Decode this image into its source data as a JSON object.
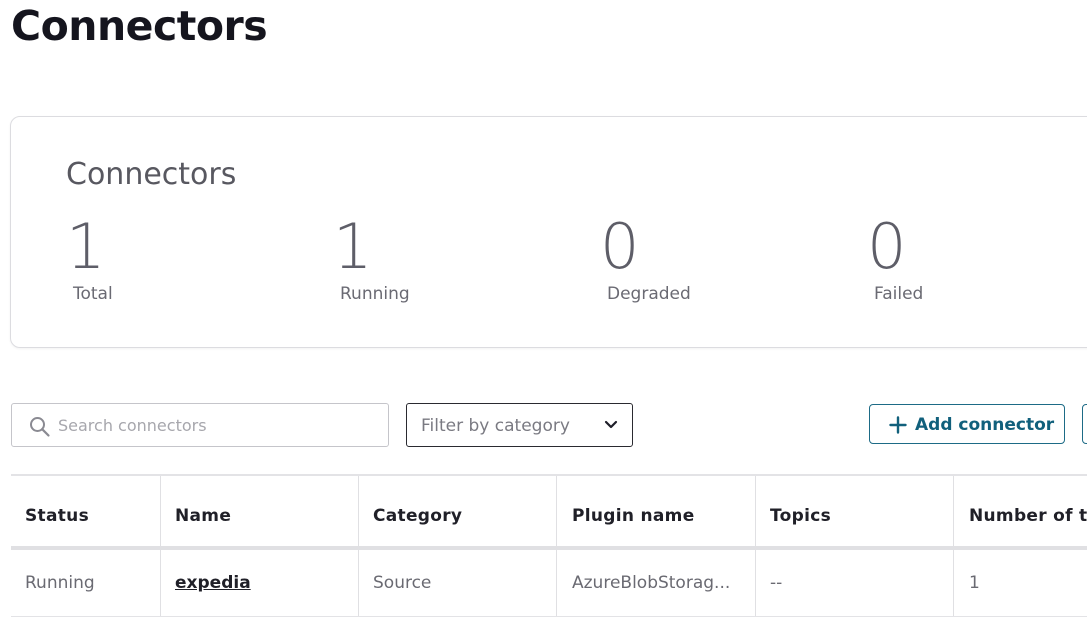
{
  "page": {
    "title": "Connectors"
  },
  "summary": {
    "title": "Connectors",
    "stats": [
      {
        "value": "1",
        "label": "Total"
      },
      {
        "value": "1",
        "label": "Running"
      },
      {
        "value": "0",
        "label": "Degraded"
      },
      {
        "value": "0",
        "label": "Failed"
      }
    ]
  },
  "toolbar": {
    "search_placeholder": "Search connectors",
    "filter_label": "Filter by category",
    "add_label": "Add connector"
  },
  "table": {
    "columns": [
      "Status",
      "Name",
      "Category",
      "Plugin name",
      "Topics",
      "Number of ta"
    ],
    "rows": [
      {
        "status": "Running",
        "name": "expedia",
        "category": "Source",
        "plugin": "AzureBlobStorag...",
        "topics": "--",
        "tasks": "1"
      }
    ]
  },
  "colors": {
    "accent": "#11607c",
    "title_text": "#15151e",
    "muted_text": "#6a6a72",
    "border": "#dcdce0"
  },
  "icons": [
    "search-icon",
    "chevron-down-icon",
    "plus-icon"
  ]
}
